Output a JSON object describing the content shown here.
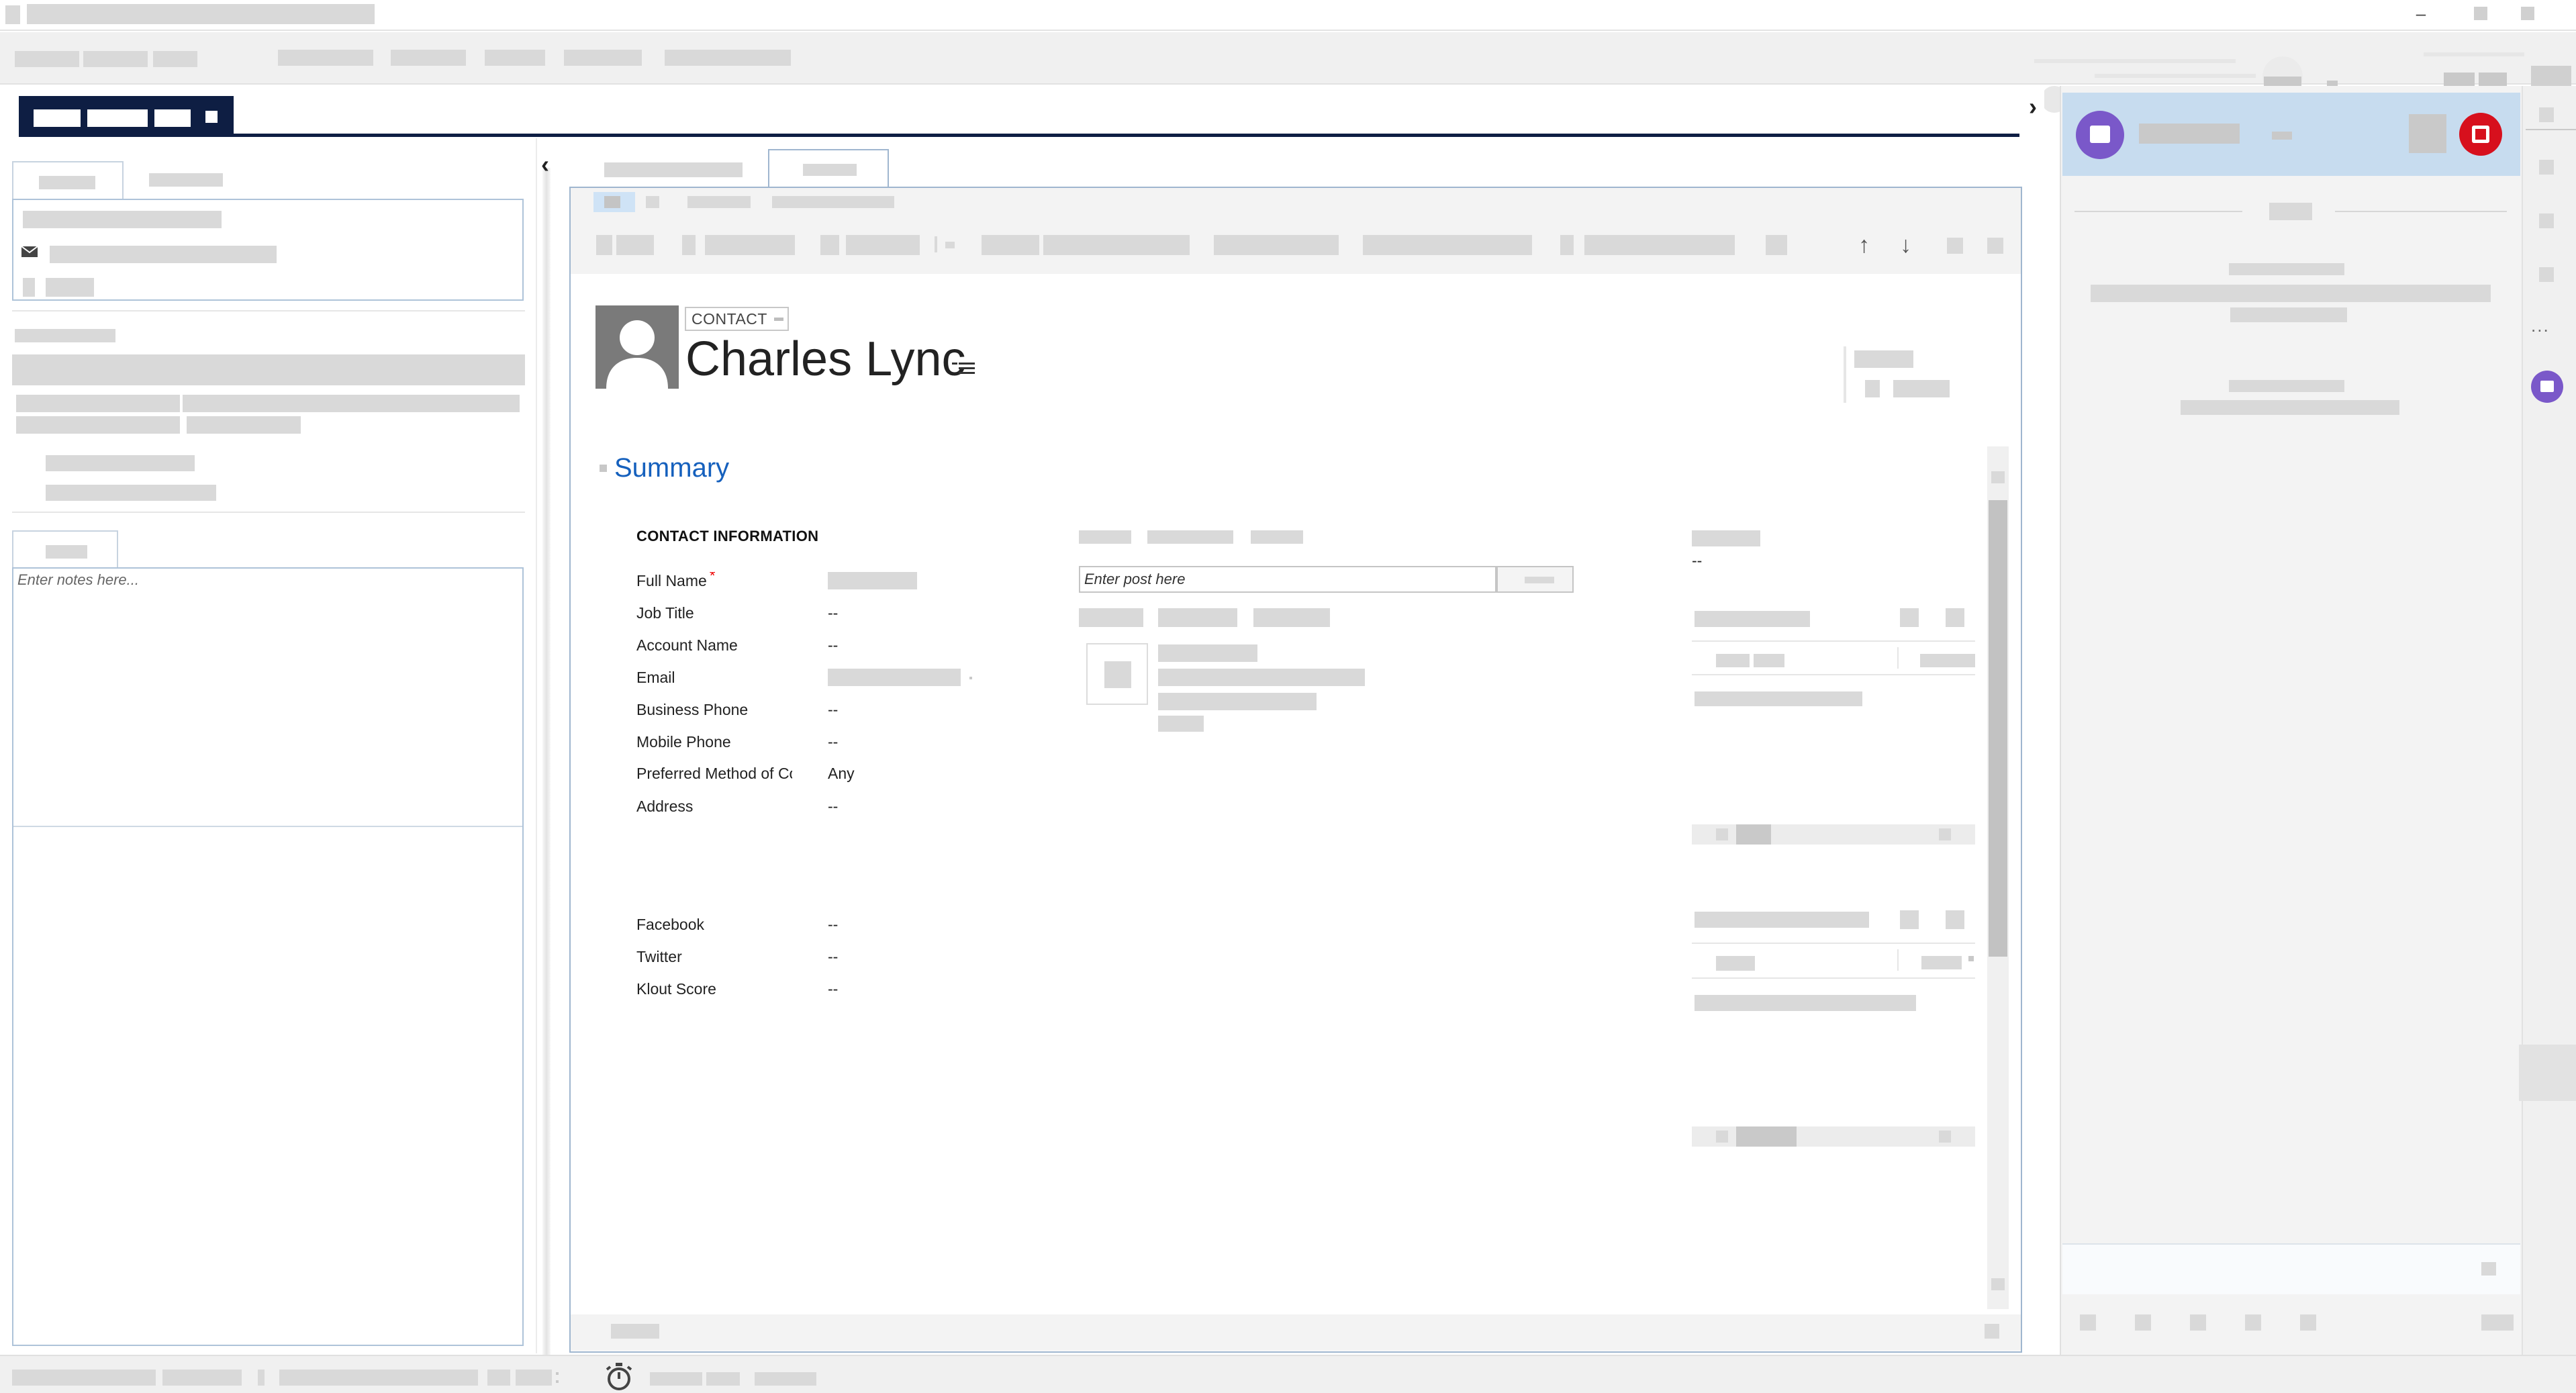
{
  "window": {
    "minimize_glyph": "–"
  },
  "navigation": {
    "collapse_left_glyph": "‹",
    "expand_right_glyph": "›"
  },
  "notes": {
    "placeholder": "Enter notes here..."
  },
  "record": {
    "entity_type": "CONTACT",
    "name": "Charles Lync",
    "avatar_icon": "person-silhouette-icon"
  },
  "toolbar": {
    "move_up_icon": "↑",
    "move_down_icon": "↓"
  },
  "summary": {
    "title": "Summary",
    "group_title": "CONTACT INFORMATION",
    "fields": [
      {
        "label": "Full Name",
        "value": "",
        "required": "*"
      },
      {
        "label": "Job Title",
        "value": "--"
      },
      {
        "label": "Account Name",
        "value": "--"
      },
      {
        "label": "Email",
        "value": ""
      },
      {
        "label": "Business Phone",
        "value": "--"
      },
      {
        "label": "Mobile Phone",
        "value": "--"
      },
      {
        "label": "Preferred Method of Contact",
        "value": "Any"
      },
      {
        "label": "Address",
        "value": "--"
      }
    ],
    "social_fields": [
      {
        "label": "Facebook",
        "value": "--"
      },
      {
        "label": "Twitter",
        "value": "--"
      },
      {
        "label": "Klout Score",
        "value": "--"
      }
    ]
  },
  "posts": {
    "placeholder": "Enter post here"
  },
  "sidebar_right": {
    "value_dash": "--"
  },
  "rail": {
    "more_glyph": "..."
  },
  "colors": {
    "nav_dark": "#0e1e43",
    "accent_blue": "#1560bd",
    "panel_header": "#c7dcef",
    "agent_purple": "#7a58c9",
    "stop_red": "#d7101d",
    "required_red": "#e00000"
  }
}
